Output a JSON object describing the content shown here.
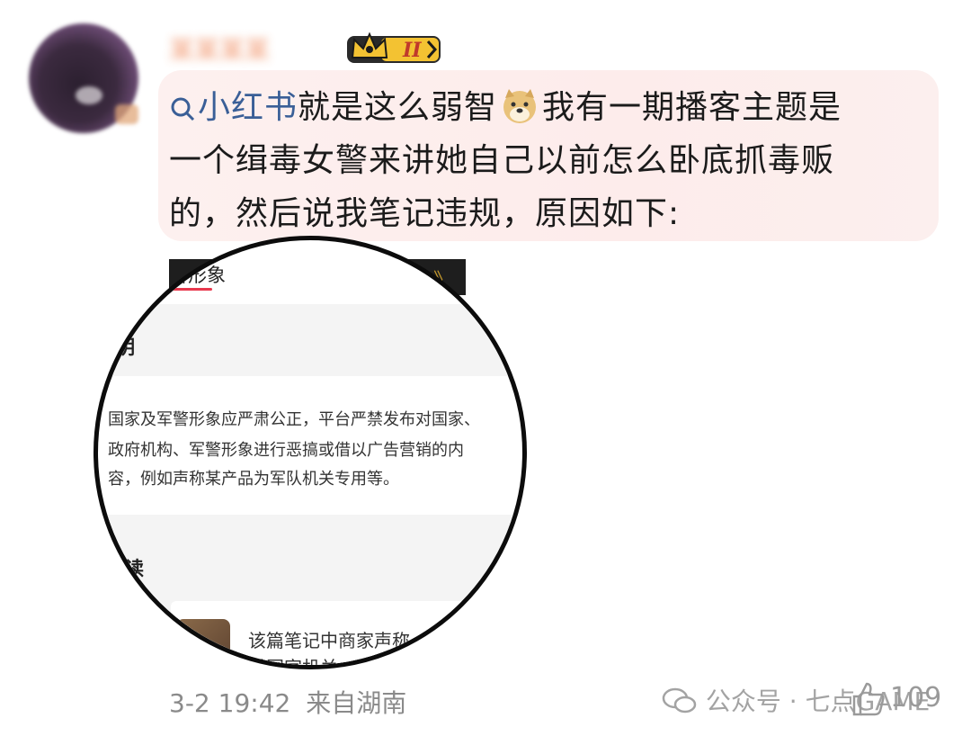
{
  "post": {
    "username": "某某某某",
    "badge_label": "II",
    "tag_text": "小红书",
    "content_lines": [
      "就是这么弱智",
      "我有一期播客主题是",
      "一个缉毒女警来讲她自己以前怎么卧底抓毒贩",
      "的，然后说我笔记违规，原因如下:"
    ],
    "emoji_icon": "doge-emoji-icon",
    "timestamp": "3-2 19:42",
    "location": "来自湖南",
    "like_count": "109"
  },
  "screenshot": {
    "tab_title": "警形象",
    "tab_chevron": "》",
    "section1_title": "说明",
    "rule_lines": [
      "国家及军警形象应严肃公正，平台严禁发布对国家、",
      "政府机构、军警形象进行恶搞或借以广告营销的内",
      "容，例如声称某产品为军队机关专用等。"
    ],
    "section2_title": "解读",
    "card_line1": "该篇笔记中商家声称",
    "card_line2": "供国家机关"
  },
  "watermark": {
    "label": "公众号 · 七点GAME"
  },
  "colors": {
    "tag_blue": "#3a5f97",
    "bubble_pink": "#fdeceb",
    "tab_red": "#e8384d",
    "badge_gold": "#f3c232"
  }
}
